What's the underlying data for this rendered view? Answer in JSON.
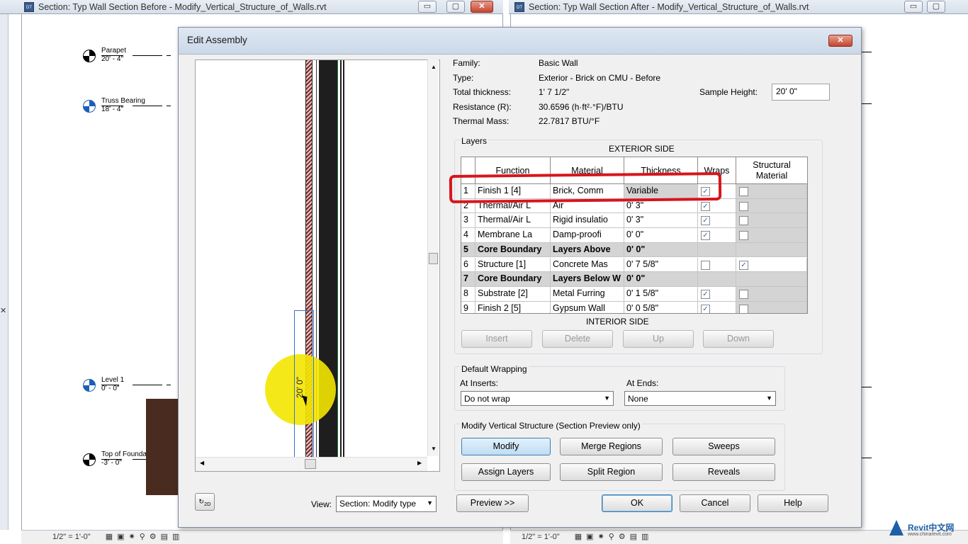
{
  "windows": {
    "left_title": "Section: Typ Wall Section Before - Modify_Vertical_Structure_of_Walls.rvt",
    "right_title": "Section: Typ Wall Section After - Modify_Vertical_Structure_of_Walls.rvt",
    "min_glyph": "▭",
    "max_glyph": "▢",
    "close_glyph": "✕"
  },
  "levels": [
    {
      "name": "Parapet",
      "elev": "20' - 4\"",
      "kind": "black"
    },
    {
      "name": "Truss Bearing",
      "elev": "18' - 4\"",
      "kind": "blue"
    },
    {
      "name": "Level 1",
      "elev": "0' - 0\"",
      "kind": "blue"
    },
    {
      "name": "Top of Foundation",
      "elev": "-3' - 0\"",
      "kind": "black"
    }
  ],
  "dialog": {
    "title": "Edit Assembly",
    "close": "✕",
    "props": {
      "family_label": "Family:",
      "family": "Basic Wall",
      "type_label": "Type:",
      "type": "Exterior - Brick on CMU - Before",
      "thickness_label": "Total thickness:",
      "thickness": "1'  7 1/2\"",
      "resistance_label": "Resistance (R):",
      "resistance": "30.6596 (h·ft²·°F)/BTU",
      "mass_label": "Thermal Mass:",
      "mass": "22.7817 BTU/°F",
      "sample_label": "Sample Height:",
      "sample": "20'  0\""
    },
    "layers_label": "Layers",
    "exterior_side": "EXTERIOR SIDE",
    "interior_side": "INTERIOR SIDE",
    "columns": [
      "Function",
      "Material",
      "Thickness",
      "Wraps",
      "Structural Material"
    ],
    "rows": [
      {
        "n": "1",
        "function": "Finish 1 [4]",
        "material": "Brick, Comm",
        "thickness": "Variable",
        "wraps": true,
        "structural": false,
        "bold": false,
        "core": false
      },
      {
        "n": "2",
        "function": "Thermal/Air L",
        "material": "Air",
        "thickness": "0'  3\"",
        "wraps": true,
        "structural": false,
        "bold": false,
        "core": false
      },
      {
        "n": "3",
        "function": "Thermal/Air L",
        "material": "Rigid insulatio",
        "thickness": "0'  3\"",
        "wraps": true,
        "structural": false,
        "bold": false,
        "core": false
      },
      {
        "n": "4",
        "function": "Membrane La",
        "material": "Damp-proofi",
        "thickness": "0'  0\"",
        "wraps": true,
        "structural": false,
        "bold": false,
        "core": false
      },
      {
        "n": "5",
        "function": "Core Boundary",
        "material": "Layers Above",
        "thickness": "0'  0\"",
        "wraps": null,
        "structural": null,
        "bold": true,
        "core": true
      },
      {
        "n": "6",
        "function": "Structure [1]",
        "material": "Concrete Mas",
        "thickness": "0'  7 5/8\"",
        "wraps": false,
        "structural": true,
        "bold": false,
        "core": false
      },
      {
        "n": "7",
        "function": "Core Boundary",
        "material": "Layers Below W",
        "thickness": "0'  0\"",
        "wraps": null,
        "structural": null,
        "bold": true,
        "core": true
      },
      {
        "n": "8",
        "function": "Substrate [2]",
        "material": "Metal Furring",
        "thickness": "0'  1 5/8\"",
        "wraps": true,
        "structural": false,
        "bold": false,
        "core": false
      },
      {
        "n": "9",
        "function": "Finish 2 [5]",
        "material": "Gypsum Wall",
        "thickness": "0'  0 5/8\"",
        "wraps": true,
        "structural": false,
        "bold": false,
        "core": false
      }
    ],
    "layer_buttons": [
      "Insert",
      "Delete",
      "Up",
      "Down"
    ],
    "default_wrapping": "Default Wrapping",
    "at_inserts_label": "At Inserts:",
    "at_inserts": "Do not wrap",
    "at_ends_label": "At Ends:",
    "at_ends": "None",
    "modify_vertical": "Modify Vertical Structure (Section Preview only)",
    "mv_buttons": [
      "Modify",
      "Merge Regions",
      "Sweeps",
      "Assign Layers",
      "Split Region",
      "Reveals"
    ],
    "view_label": "View:",
    "view": "Section: Modify type",
    "preview_btn": "Preview >>",
    "ok": "OK",
    "cancel": "Cancel",
    "help": "Help",
    "dim_text": "20'  0\""
  },
  "statusbar": {
    "scale": "1/2\" = 1'-0\""
  },
  "watermark": {
    "brand": "Revit中文网",
    "url": "www.chinarevit.com"
  },
  "colors": {
    "accent": "#3c7fb1",
    "highlight": "#d8141c",
    "cursor_halo": "#f4e600"
  }
}
